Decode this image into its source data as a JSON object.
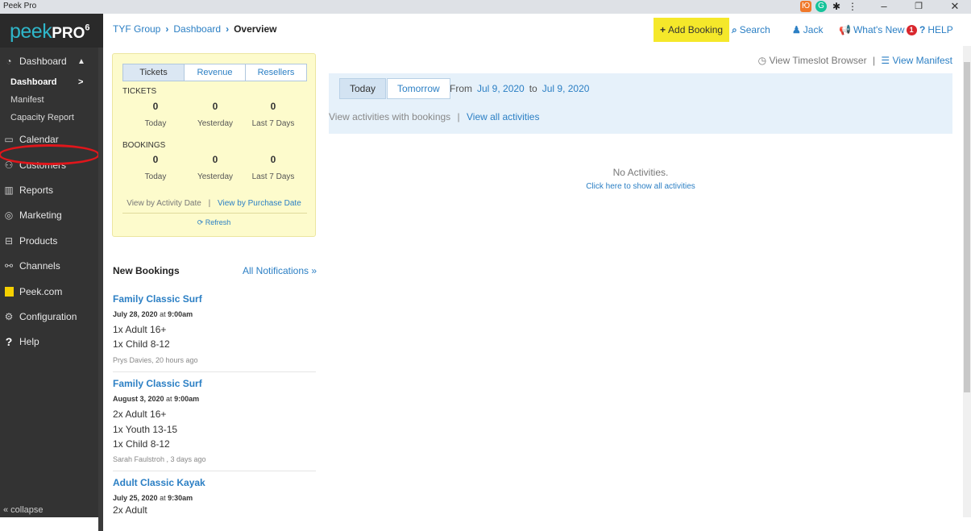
{
  "window": {
    "title": "Peek Pro"
  },
  "colors": {
    "accent": "#2b7fc4",
    "brand": "#2fb6c9",
    "add_booking_bg": "#f5e82a",
    "stats_bg": "#fdfbcc",
    "highlight": "#e0161b"
  },
  "logo": {
    "text_light": "peek",
    "text_bold": "PRO",
    "version": "6"
  },
  "sidebar": {
    "dashboard": {
      "label": "Dashboard",
      "icon": "dashboard-icon"
    },
    "sub_items": [
      {
        "label": "Dashboard",
        "arrow": ">"
      },
      {
        "label": "Manifest"
      },
      {
        "label": "Capacity Report"
      }
    ],
    "items": [
      {
        "label": "Calendar",
        "icon": "calendar-icon"
      },
      {
        "label": "Customers",
        "icon": "customers-icon"
      },
      {
        "label": "Reports",
        "icon": "reports-icon"
      },
      {
        "label": "Marketing",
        "icon": "marketing-icon"
      },
      {
        "label": "Products",
        "icon": "products-icon"
      },
      {
        "label": "Channels",
        "icon": "channels-icon"
      },
      {
        "label": "Peek.com",
        "icon": "peek-com-icon"
      },
      {
        "label": "Configuration",
        "icon": "gear-icon"
      },
      {
        "label": "Help",
        "icon": "question-icon"
      }
    ],
    "collapse": "« collapse"
  },
  "breadcrumb": {
    "items": [
      "TYF Group",
      "Dashboard",
      "Overview"
    ]
  },
  "topnav": {
    "add_booking": "Add Booking",
    "search": "Search",
    "user": "Jack",
    "whats_new": "What's New",
    "whats_new_count": "1",
    "help": "HELP"
  },
  "stats": {
    "tabs": [
      "Tickets",
      "Revenue",
      "Resellers"
    ],
    "tickets": {
      "label": "TICKETS",
      "values": [
        "0",
        "0",
        "0"
      ],
      "captions": [
        "Today",
        "Yesterday",
        "Last 7 Days"
      ]
    },
    "bookings": {
      "label": "BOOKINGS",
      "values": [
        "0",
        "0",
        "0"
      ],
      "captions": [
        "Today",
        "Yesterday",
        "Last 7 Days"
      ]
    },
    "view_activity": "View by Activity Date",
    "view_purchase": "View by Purchase Date",
    "refresh": "Refresh"
  },
  "new_bookings": {
    "heading": "New Bookings",
    "all_link": "All Notifications »",
    "items": [
      {
        "title": "Family Classic Surf",
        "date": "July 28, 2020",
        "at": "at",
        "time": "9:00am",
        "lines": [
          "1x Adult 16+",
          "1x Child 8-12"
        ],
        "by": "Prys Davies, 20 hours ago"
      },
      {
        "title": "Family Classic Surf",
        "date": "August 3, 2020",
        "at": "at",
        "time": "9:00am",
        "lines": [
          "2x Adult 16+",
          "1x Youth 13-15",
          "1x Child 8-12"
        ],
        "by": "Sarah Faulstroh , 3 days ago"
      },
      {
        "title": "Adult Classic Kayak",
        "date": "July 25, 2020",
        "at": "at",
        "time": "9:30am",
        "lines": [
          "2x Adult"
        ]
      }
    ]
  },
  "main": {
    "timeslot_browser": "View Timeslot Browser",
    "view_manifest": "View Manifest",
    "day_today": "Today",
    "day_tomorrow": "Tomorrow",
    "from_label": "From",
    "from_date": "Jul 9, 2020",
    "to_label": "to",
    "to_date": "Jul 9, 2020",
    "with_bookings": "View activities with bookings",
    "view_all": "View all activities",
    "no_activities": "No Activities.",
    "show_all": "Click here to show all activities"
  }
}
